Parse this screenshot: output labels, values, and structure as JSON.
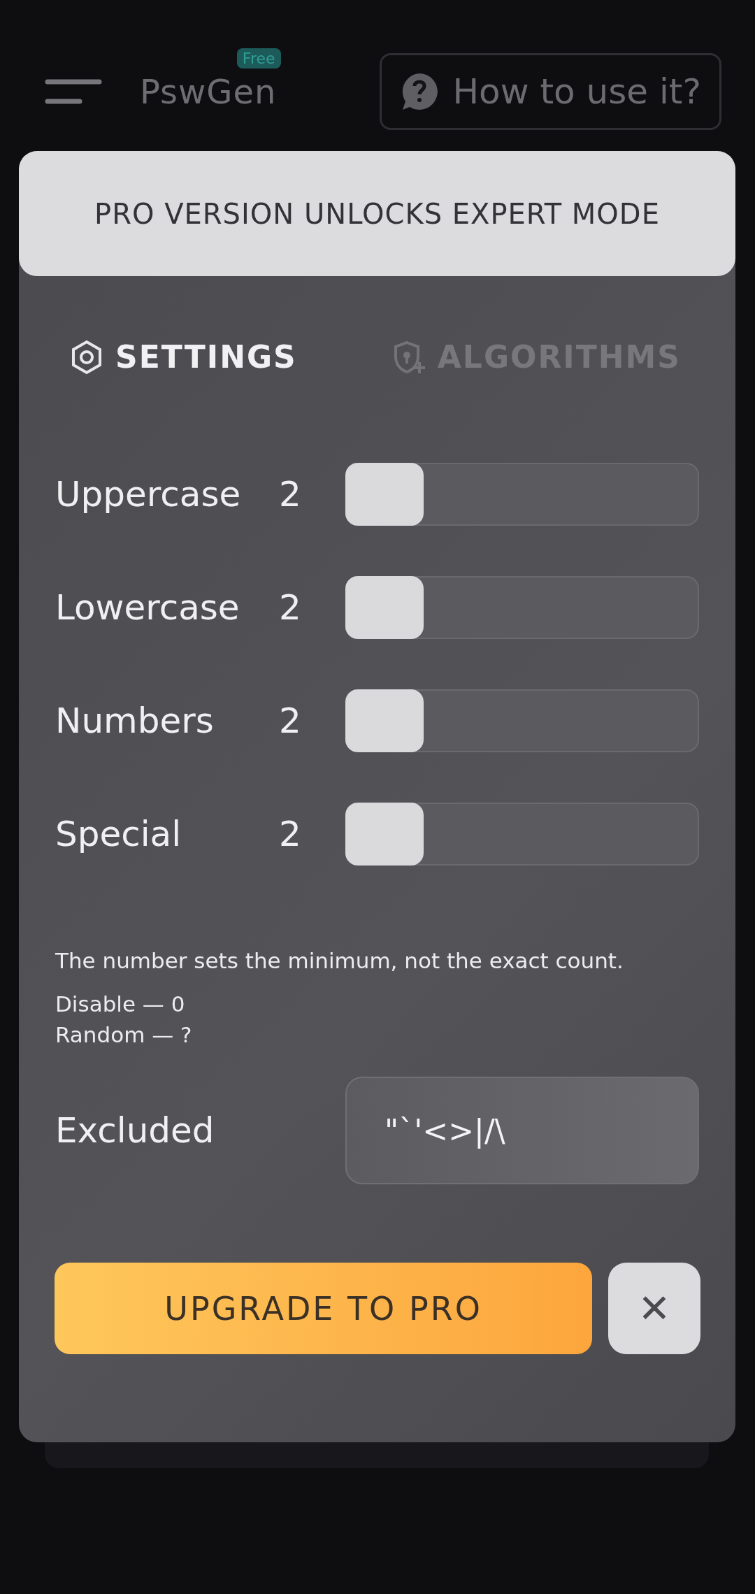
{
  "header": {
    "app_name": "PswGen",
    "badge": "Free",
    "help_button": "How to use it?"
  },
  "banner": {
    "title": "PRO VERSION UNLOCKS EXPERT MODE"
  },
  "tabs": [
    {
      "label": "SETTINGS",
      "selected": true,
      "kind": "gear"
    },
    {
      "label": "ALGORITHMS",
      "selected": false,
      "kind": "shield"
    }
  ],
  "sliders": [
    {
      "label": "Uppercase",
      "value": "2",
      "level": 0
    },
    {
      "label": "Lowercase",
      "value": "2",
      "level": 0
    },
    {
      "label": "Numbers",
      "value": "2",
      "level": 0
    },
    {
      "label": "Special",
      "value": "2",
      "level": 0
    }
  ],
  "note": "The number sets the minimum, not the exact count.",
  "hints": [
    "Disable — 0",
    "Random — ?"
  ],
  "excluded": {
    "label": "Excluded",
    "value": "\"`'<>|/\\"
  },
  "buttons": {
    "upgrade": "UPGRADE TO PRO",
    "close": "✕"
  }
}
